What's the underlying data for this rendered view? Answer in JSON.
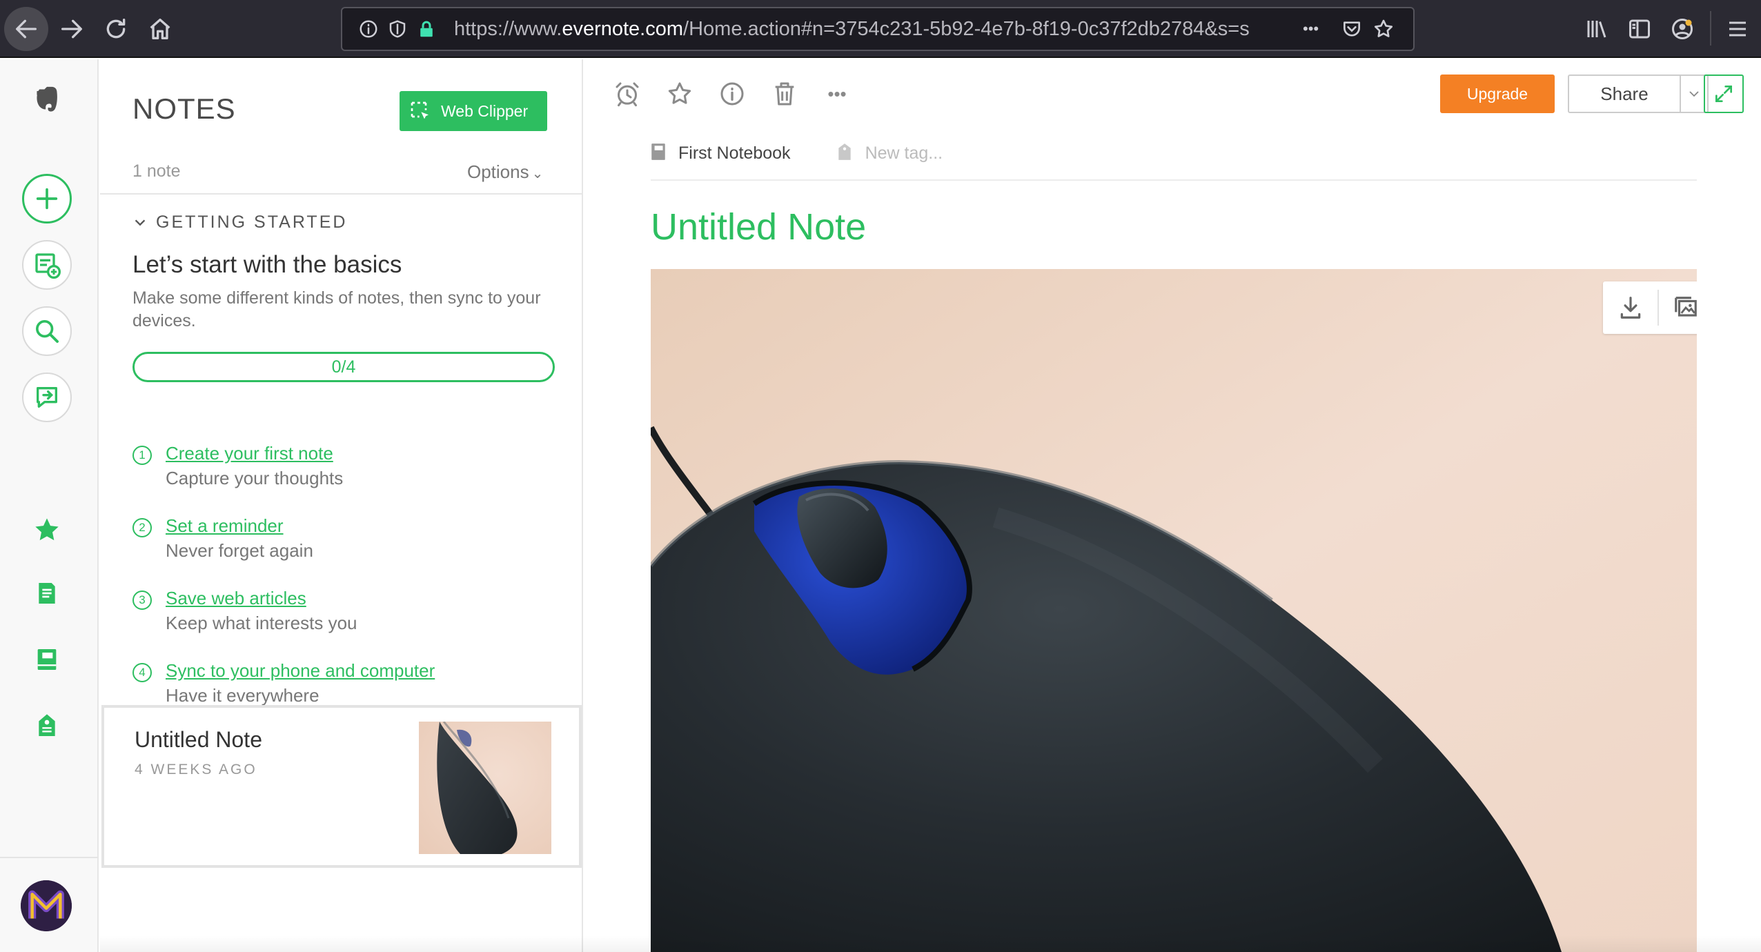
{
  "browser": {
    "url_prefix": "https://www.",
    "url_domain": "evernote.com",
    "url_rest": "/Home.action#n=3754c231-5b92-4e7b-8f19-0c37f2db2784&s=s",
    "menu_dots": "•••"
  },
  "notes_panel": {
    "title": "NOTES",
    "web_clipper_label": "Web Clipper",
    "note_count": "1 note",
    "options_label": "Options"
  },
  "getting_started": {
    "header": "GETTING STARTED",
    "title": "Let’s start with the basics",
    "description": "Make some different kinds of notes, then sync to your devices.",
    "progress_text": "0/4",
    "progress": 0,
    "steps": [
      {
        "num": "1",
        "link": "Create your first note",
        "sub": "Capture your thoughts"
      },
      {
        "num": "2",
        "link": "Set a reminder",
        "sub": "Never forget again"
      },
      {
        "num": "3",
        "link": "Save web articles",
        "sub": "Keep what interests you"
      },
      {
        "num": "4",
        "link": "Sync to your phone and computer",
        "sub": "Have it everywhere"
      }
    ]
  },
  "note_list": [
    {
      "title": "Untitled Note",
      "date": "4 WEEKS AGO"
    }
  ],
  "editor": {
    "upgrade_label": "Upgrade",
    "share_label": "Share",
    "more_dots": "•••",
    "notebook": "First Notebook",
    "tag_placeholder": "New tag...",
    "note_title": "Untitled Note"
  },
  "colors": {
    "brand_green": "#2dbe60",
    "upgrade_orange": "#f48024",
    "browser_chrome": "#2b2a33"
  },
  "icons": {
    "rail": [
      "evernote-logo-icon",
      "new-note-icon",
      "new-chat-icon",
      "search-icon",
      "work-chat-icon",
      "shortcuts-star-icon",
      "notes-icon",
      "notebooks-icon",
      "tags-icon"
    ],
    "editor_toolbar": [
      "reminder-alarm-icon",
      "shortcut-star-icon",
      "note-info-icon",
      "trash-icon",
      "more-actions-icon"
    ]
  }
}
